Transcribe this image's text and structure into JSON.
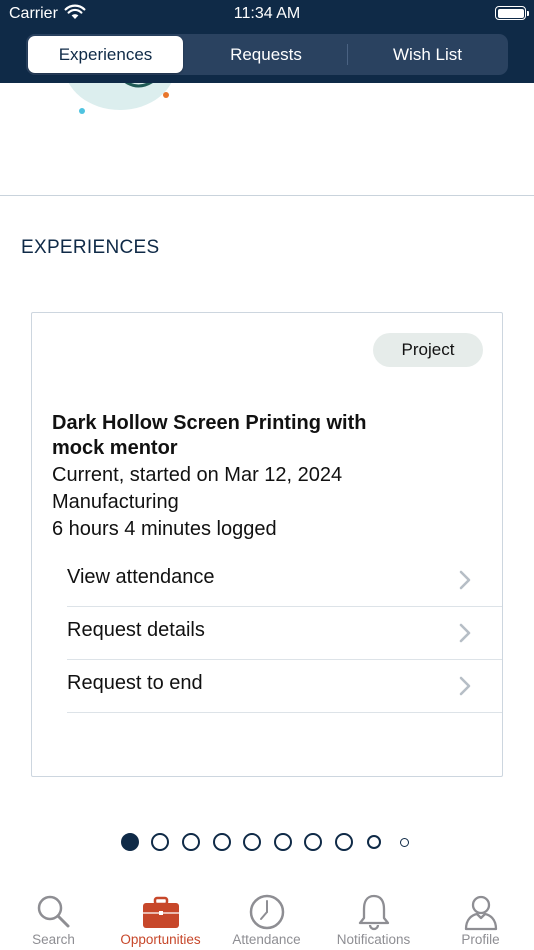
{
  "status_bar": {
    "carrier": "Carrier",
    "time": "11:34 AM"
  },
  "segmented": {
    "tabs": [
      {
        "label": "Experiences",
        "active": true
      },
      {
        "label": "Requests",
        "active": false
      },
      {
        "label": "Wish List",
        "active": false
      }
    ]
  },
  "section": {
    "title": "EXPERIENCES"
  },
  "card": {
    "badge": "Project",
    "title": "Dark Hollow Screen Printing with mock mentor",
    "status": "Current, started on Mar 12, 2024",
    "category": "Manufacturing",
    "hours": "6 hours 4 minutes logged",
    "actions": [
      {
        "label": "View attendance",
        "icon": "chevron-right-icon"
      },
      {
        "label": "Request details",
        "icon": "chevron-right-icon"
      },
      {
        "label": "Request to end",
        "icon": "chevron-right-icon"
      }
    ]
  },
  "pager": {
    "total": 10,
    "current": 1
  },
  "tab_bar": {
    "items": [
      {
        "label": "Search",
        "icon": "search-icon",
        "active": false
      },
      {
        "label": "Opportunities",
        "icon": "briefcase-icon",
        "active": true
      },
      {
        "label": "Attendance",
        "icon": "clock-icon",
        "active": false
      },
      {
        "label": "Notifications",
        "icon": "bell-icon",
        "active": false
      },
      {
        "label": "Profile",
        "icon": "person-icon",
        "active": false
      }
    ]
  },
  "colors": {
    "navy": "#0f2a47",
    "accent": "#c7472a",
    "inactive_tab": "#8e8e93"
  }
}
